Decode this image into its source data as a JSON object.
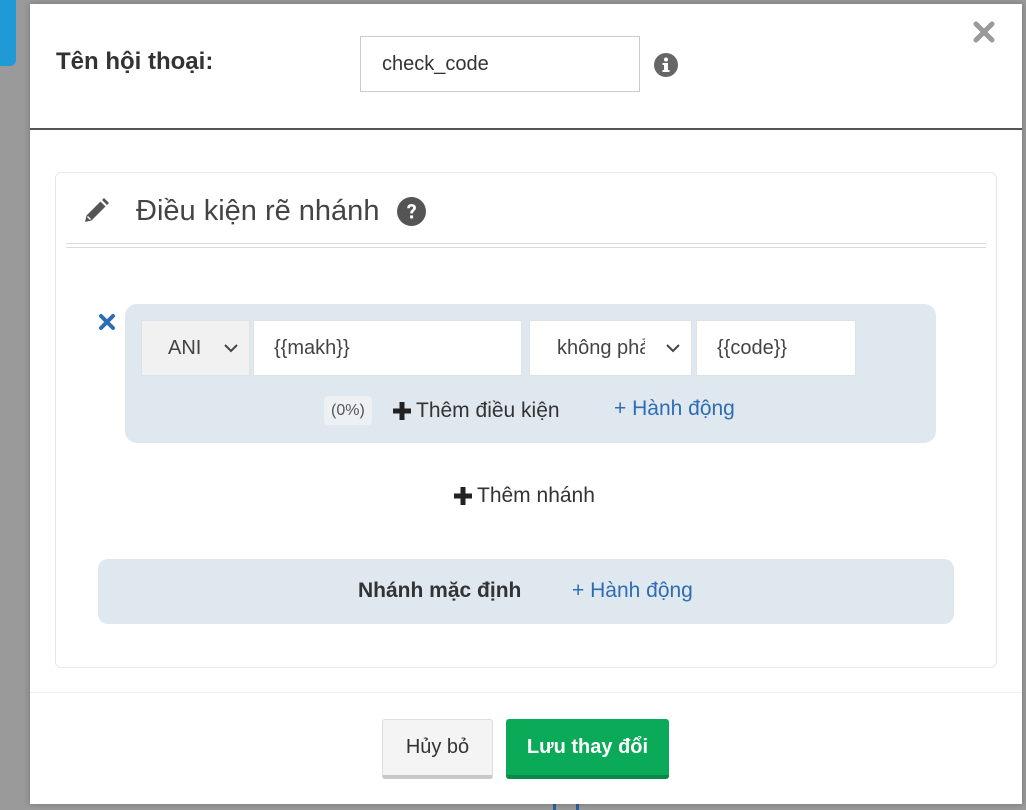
{
  "header": {
    "dialog_name_label": "Tên hội thoại:",
    "dialog_name_value": "check_code",
    "close_symbol": "✕"
  },
  "panel": {
    "title": "Điều kiện rẽ nhánh"
  },
  "branch": {
    "field_value": "ANI",
    "left_value": "{{makh}}",
    "operator_value": "không phải",
    "right_value": "{{code}}",
    "percent": "(0%)",
    "add_condition_label": "Thêm điều kiện",
    "action_label": "+ Hành động"
  },
  "add_branch_label": "Thêm nhánh",
  "default_branch": {
    "label": "Nhánh mặc định",
    "action_label": "+ Hành động"
  },
  "footer": {
    "cancel_label": "Hủy bỏ",
    "save_label": "Lưu thay đổi"
  },
  "colors": {
    "accent_blue": "#2e6db4",
    "save_green": "#0aaa58",
    "branch_background": "#dfe7ef"
  },
  "icons": [
    "info-icon",
    "close-icon",
    "pencil-icon",
    "help-icon",
    "remove-icon",
    "chevron-down-icon",
    "plus-icon"
  ]
}
